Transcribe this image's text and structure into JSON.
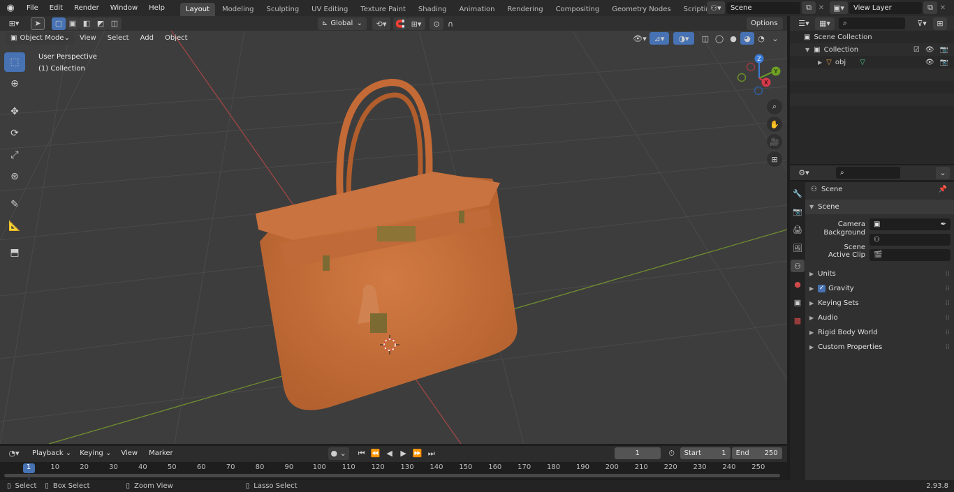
{
  "topbar": {
    "menus": [
      "File",
      "Edit",
      "Render",
      "Window",
      "Help"
    ],
    "workspaces": [
      "Layout",
      "Modeling",
      "Sculpting",
      "UV Editing",
      "Texture Paint",
      "Shading",
      "Animation",
      "Rendering",
      "Compositing",
      "Geometry Nodes",
      "Scripting"
    ],
    "active_workspace": "Layout",
    "add_tab": "+",
    "scene_name": "Scene",
    "view_layer": "View Layer"
  },
  "header2": {
    "orientation": "Global",
    "options": "Options"
  },
  "viewport_header": {
    "mode": "Object Mode",
    "menus": [
      "View",
      "Select",
      "Add",
      "Object"
    ]
  },
  "viewport": {
    "perspective": "User Perspective",
    "collection": "(1) Collection",
    "colors": {
      "grid_bg": "#3d3d3d",
      "bag": "#c8703a",
      "x_axis": "#c84a4a",
      "y_axis": "#7ea034"
    },
    "gizmo": {
      "z": "Z",
      "y": "Y",
      "x": "X"
    }
  },
  "outliner": {
    "scene_collection": "Scene Collection",
    "collection": "Collection",
    "object": "obj"
  },
  "properties": {
    "header": "Scene",
    "panel": "Scene",
    "fields": [
      {
        "label": "Camera"
      },
      {
        "label": "Background Scene"
      },
      {
        "label": "Active Clip"
      }
    ],
    "subpanels": [
      "Units",
      "Gravity",
      "Keying Sets",
      "Audio",
      "Rigid Body World",
      "Custom Properties"
    ]
  },
  "timeline": {
    "menus": [
      "Playback",
      "Keying",
      "View",
      "Marker"
    ],
    "current_frame": "1",
    "start_label": "Start",
    "start": "1",
    "end_label": "End",
    "end": "250",
    "ruler": [
      "1",
      "10",
      "20",
      "30",
      "40",
      "50",
      "60",
      "70",
      "80",
      "90",
      "100",
      "110",
      "120",
      "130",
      "140",
      "150",
      "160",
      "170",
      "180",
      "190",
      "200",
      "210",
      "220",
      "230",
      "240",
      "250"
    ]
  },
  "statusbar": {
    "select": "Select",
    "box_select": "Box Select",
    "zoom_view": "Zoom View",
    "lasso_select": "Lasso Select",
    "version": "2.93.8"
  }
}
